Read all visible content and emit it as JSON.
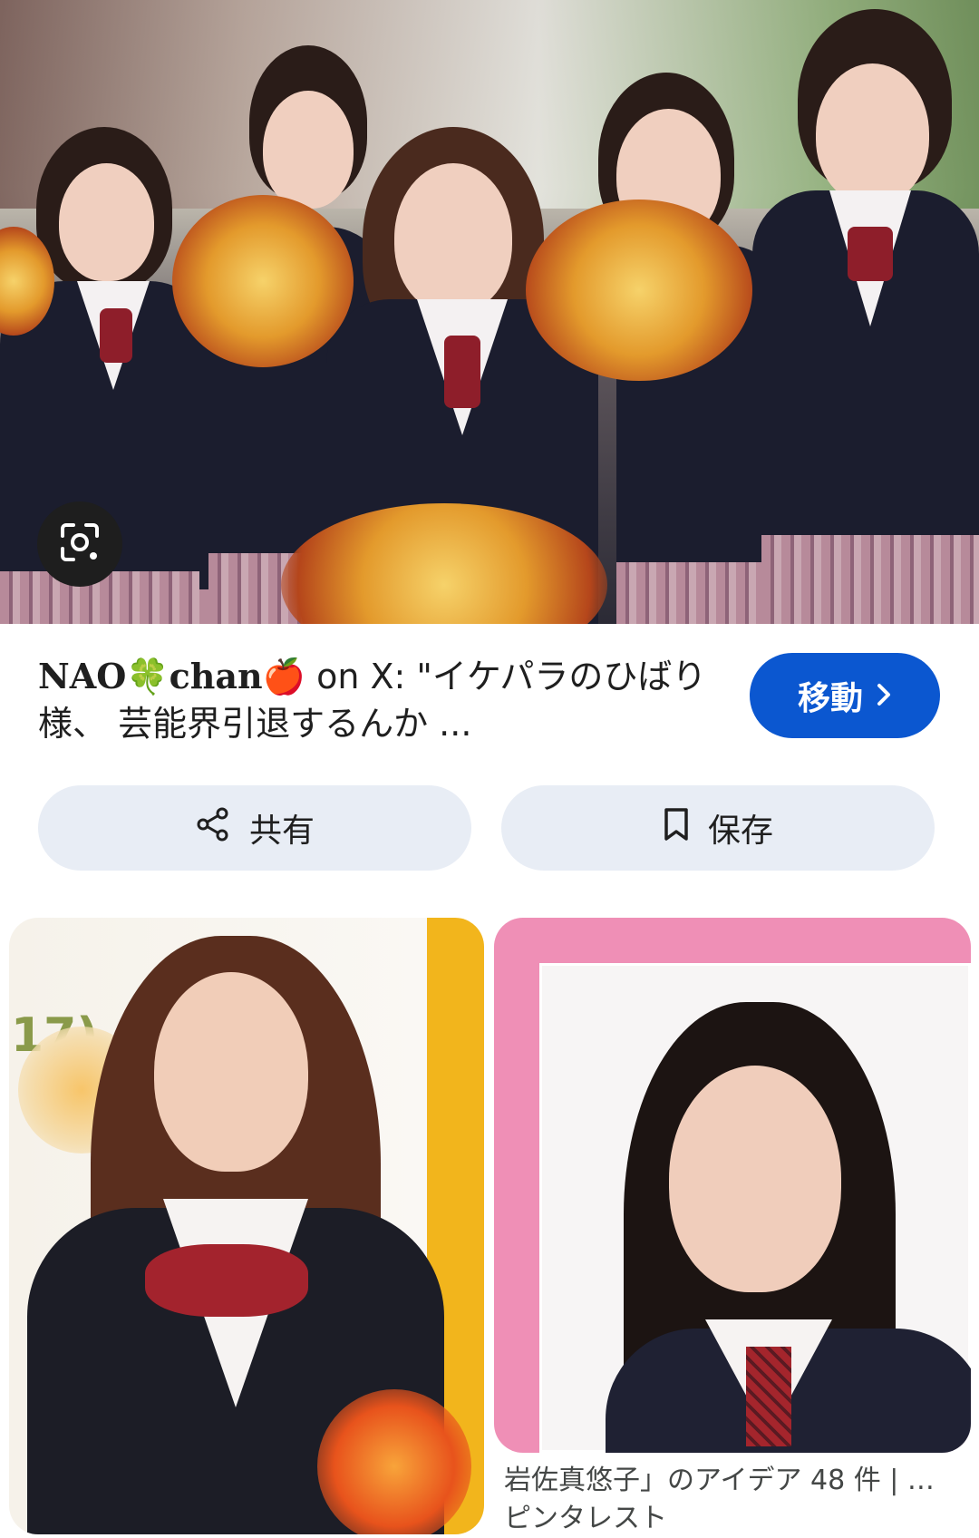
{
  "result": {
    "title_serif_1": "NAO",
    "title_serif_2": "chan",
    "title_rest": " on X: \"イケパラのひばり様、 芸能界引退するんか ...",
    "clover_icon": "clover-emoji",
    "apple_icon": "red-apple-emoji"
  },
  "go_button": {
    "label": "移動"
  },
  "actions": {
    "share_label": "共有",
    "save_label": "保存"
  },
  "related": {
    "right_caption": "岩佐真悠子」のアイデア 48 件 | …",
    "right_caption_line2": "ピンタレスト"
  },
  "left_card_number": "17)",
  "colors": {
    "go_button": "#0b57d0",
    "action_bg": "#e8edf5",
    "card_right_frame": "#ef8fb6",
    "card_left_edge": "#f2b51c"
  }
}
